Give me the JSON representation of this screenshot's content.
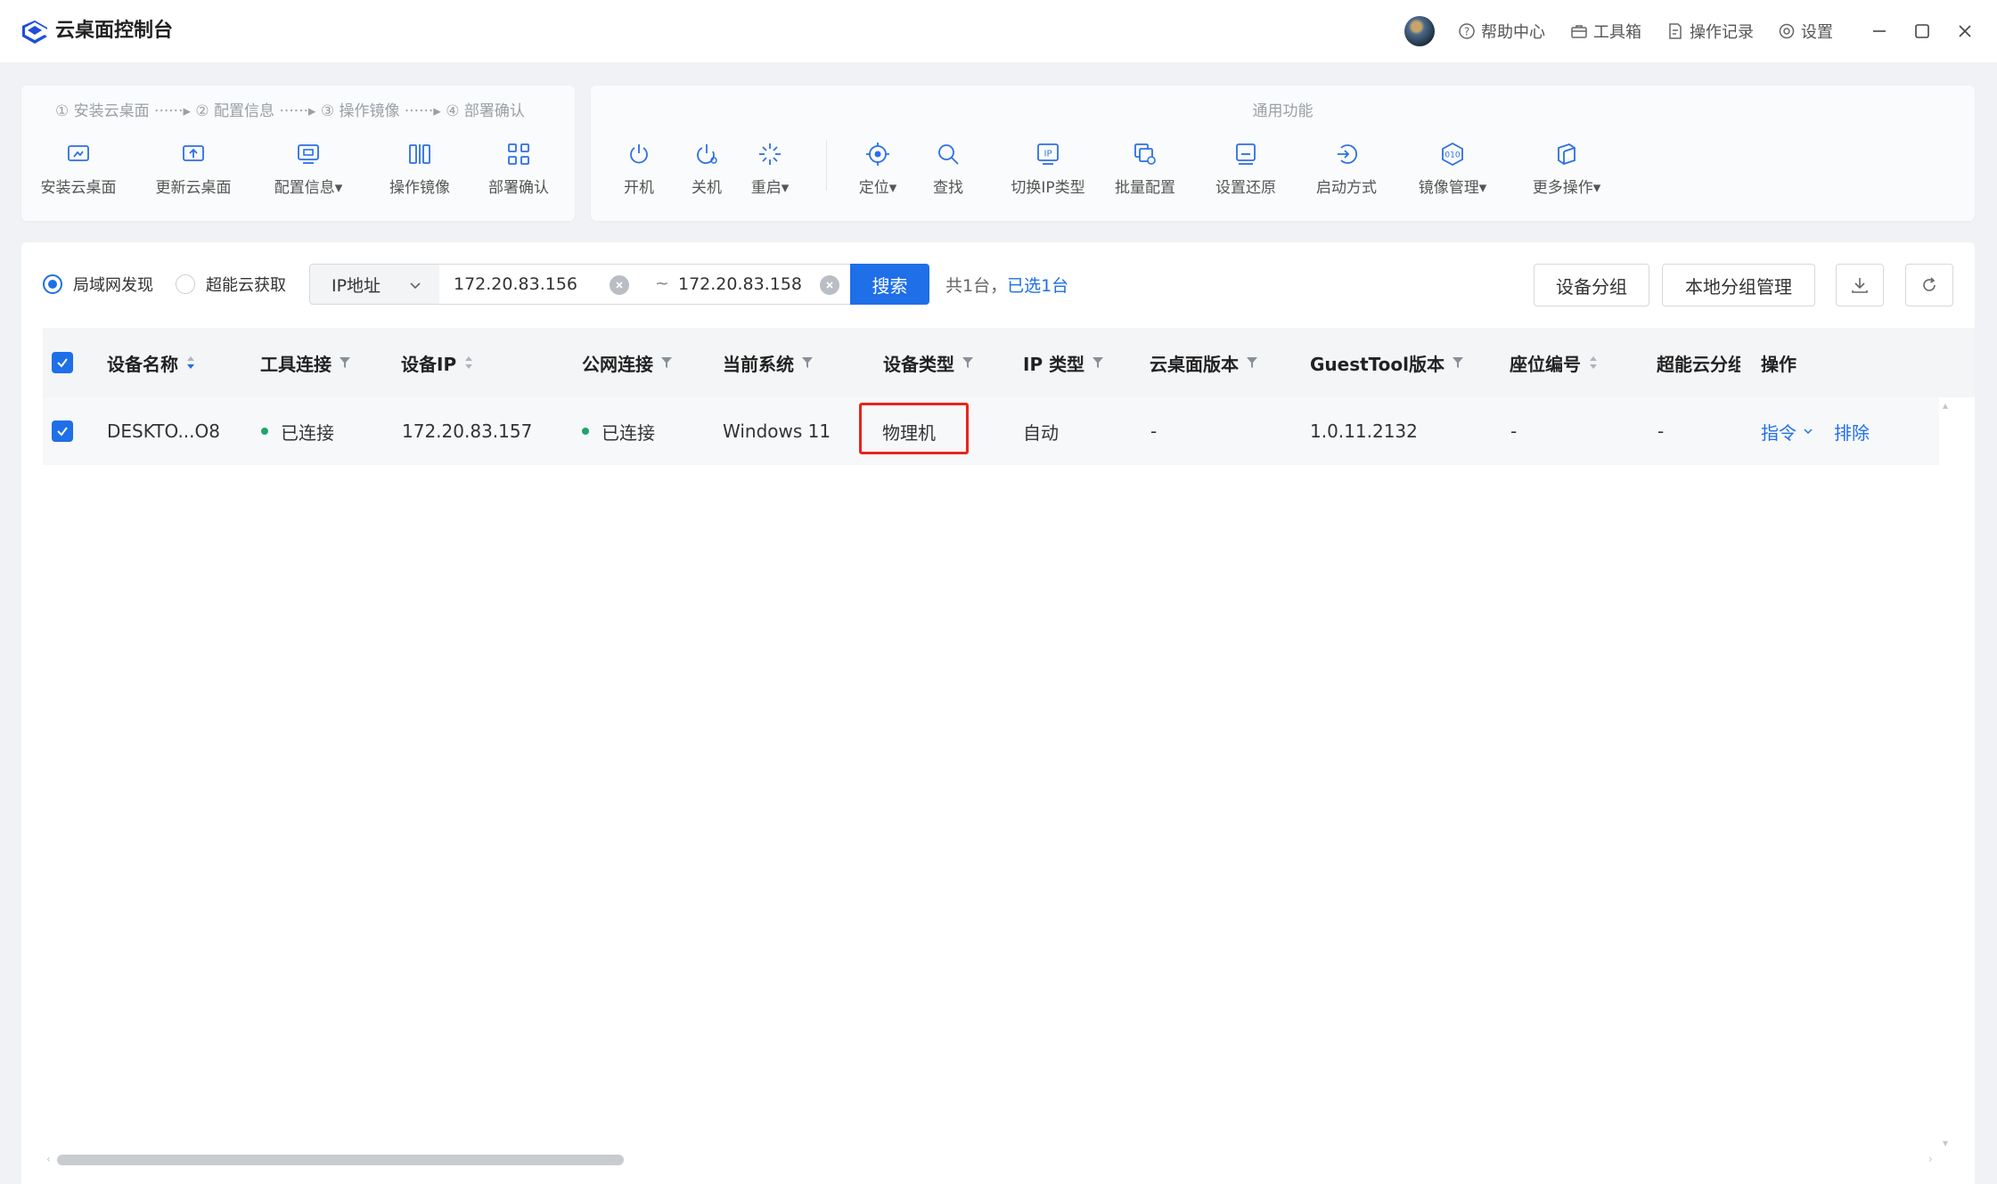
{
  "app": {
    "title": "云桌面控制台"
  },
  "topbar": {
    "links": [
      {
        "label": "帮助中心",
        "icon": "help-circle-icon"
      },
      {
        "label": "工具箱",
        "icon": "toolbox-icon"
      },
      {
        "label": "操作记录",
        "icon": "record-icon"
      },
      {
        "label": "设置",
        "icon": "gear-icon"
      }
    ]
  },
  "steps": {
    "line": "① 安装云桌面 ······▸ ② 配置信息 ······▸ ③ 操作镜像 ······▸ ④ 部署确认",
    "tools": [
      {
        "label": "安装云桌面",
        "icon": "install-desktop-icon"
      },
      {
        "label": "更新云桌面",
        "icon": "update-desktop-icon"
      },
      {
        "label": "配置信息▾",
        "icon": "config-monitor-icon"
      },
      {
        "label": "操作镜像",
        "icon": "mirror-image-icon"
      },
      {
        "label": "部署确认",
        "icon": "deploy-confirm-icon"
      }
    ]
  },
  "functions": {
    "header": "通用功能",
    "tools": [
      {
        "label": "开机",
        "icon": "power-on-icon"
      },
      {
        "label": "关机",
        "icon": "power-off-icon"
      },
      {
        "label": "重启▾",
        "icon": "restart-icon"
      },
      {
        "label": "定位▾",
        "icon": "locate-icon"
      },
      {
        "label": "查找",
        "icon": "search-icon"
      },
      {
        "label": "切换IP类型",
        "icon": "switch-ip-icon"
      },
      {
        "label": "批量配置",
        "icon": "batch-config-icon"
      },
      {
        "label": "设置还原",
        "icon": "restore-icon"
      },
      {
        "label": "启动方式",
        "icon": "boot-mode-icon"
      },
      {
        "label": "镜像管理▾",
        "icon": "image-manage-icon"
      },
      {
        "label": "更多操作▾",
        "icon": "more-ops-icon"
      }
    ]
  },
  "filters": {
    "discovery_options": [
      "局域网发现",
      "超能云获取"
    ],
    "discovery_selected": "局域网发现",
    "ip_type": "IP地址",
    "ip_start": "172.20.83.156",
    "ip_end": "172.20.83.158",
    "range_sep": "~",
    "search_label": "搜索",
    "count_text": "共1台，",
    "selected_text": "已选1台",
    "group_button": "设备分组",
    "local_group_button": "本地分组管理"
  },
  "table": {
    "columns": [
      "设备名称",
      "工具连接",
      "设备IP",
      "公网连接",
      "当前系统",
      "设备类型",
      "IP 类型",
      "云桌面版本",
      "GuestTool版本",
      "座位编号",
      "超能云分组",
      "操作"
    ],
    "rows": [
      {
        "name": "DESKTO...O8",
        "tool_conn": "已连接",
        "ip": "172.20.83.157",
        "public_conn": "已连接",
        "os": "Windows 11",
        "device_type": "物理机",
        "ip_type": "自动",
        "desktop_version": "-",
        "guesttool_version": "1.0.11.2132",
        "seat": "-",
        "cloud_group": "-",
        "action_cmd": "指令",
        "action_remove": "排除"
      }
    ]
  },
  "colors": {
    "accent": "#1e6fe8",
    "connected": "#20a46b",
    "highlight": "#e8241c"
  }
}
